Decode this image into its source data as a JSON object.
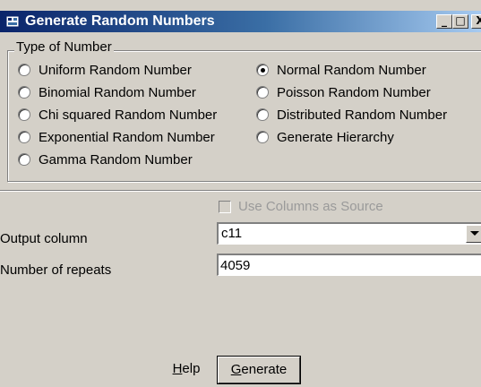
{
  "window": {
    "title": "Generate Random Numbers",
    "icon": "app-icon",
    "controls": {
      "minimize": "_",
      "maximize": "□",
      "close": "X"
    }
  },
  "type_group": {
    "legend": "Type of Number",
    "options": [
      {
        "label": "Uniform Random Number",
        "checked": false
      },
      {
        "label": "Binomial Random Number",
        "checked": false
      },
      {
        "label": "Chi squared Random Number",
        "checked": false
      },
      {
        "label": "Exponential Random Number",
        "checked": false
      },
      {
        "label": "Gamma Random Number",
        "checked": false
      },
      {
        "label": "Normal Random Number",
        "checked": true
      },
      {
        "label": "Poisson Random Number",
        "checked": false
      },
      {
        "label": "Distributed Random Number",
        "checked": false
      },
      {
        "label": "Generate Hierarchy",
        "checked": false
      }
    ]
  },
  "source": {
    "label": "Use Columns as Source",
    "checked": false,
    "enabled": false
  },
  "output_column": {
    "label": "Output column",
    "value": "c11"
  },
  "repeats": {
    "label": "Number of repeats",
    "value": "4059"
  },
  "buttons": {
    "help": {
      "mnemonic": "H",
      "rest": "elp"
    },
    "generate": {
      "mnemonic": "G",
      "rest": "enerate"
    }
  }
}
